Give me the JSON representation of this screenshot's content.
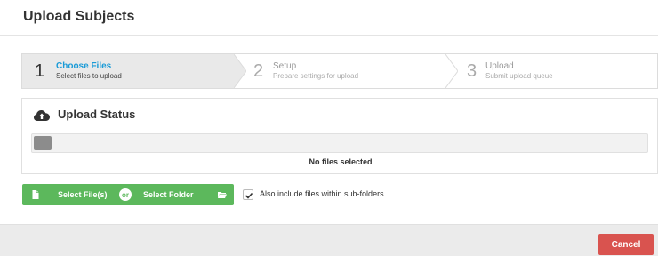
{
  "dialog": {
    "title": "Upload Subjects"
  },
  "wizard": {
    "steps": [
      {
        "number": "1",
        "title": "Choose Files",
        "subtitle": "Select files to upload",
        "state": "active"
      },
      {
        "number": "2",
        "title": "Setup",
        "subtitle": "Prepare settings for upload",
        "state": "inactive"
      },
      {
        "number": "3",
        "title": "Upload",
        "subtitle": "Submit upload queue",
        "state": "inactive"
      }
    ]
  },
  "upload_status": {
    "title": "Upload Status",
    "icon": "cloud-upload-icon",
    "message": "No files selected",
    "progress": 0
  },
  "actions": {
    "select_files_label": "Select File(s)",
    "select_files_icon": "file-icon",
    "or_label": "or",
    "select_folder_label": "Select Folder",
    "select_folder_icon": "folder-open-icon",
    "include_subfolders_label": "Also include files within sub-folders",
    "include_subfolders_checked": true
  },
  "footer": {
    "cancel_label": "Cancel"
  },
  "colors": {
    "active_step": "#1a9bd7",
    "green": "#5cb85c",
    "danger": "#d9534f"
  }
}
